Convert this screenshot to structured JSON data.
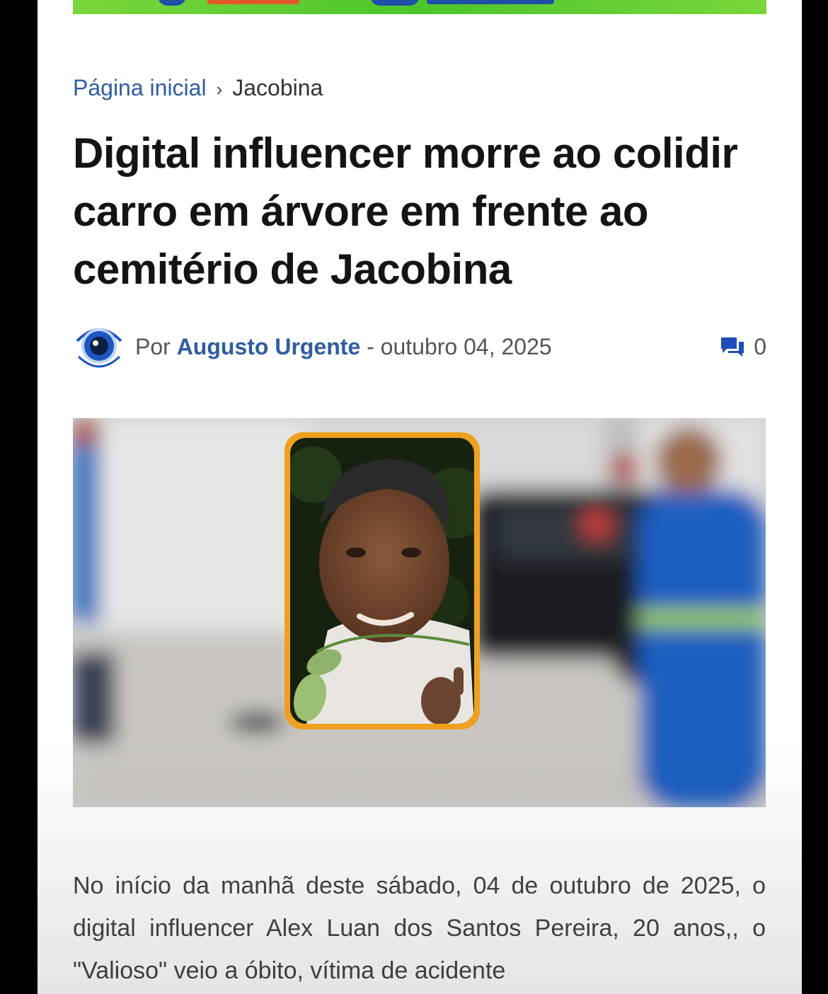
{
  "breadcrumb": {
    "home": "Página inicial",
    "separator": "›",
    "current": "Jacobina"
  },
  "article": {
    "title": "Digital influencer morre ao colidir carro em árvore em frente ao cemitério de Jacobina",
    "by_label": "Por",
    "author": "Augusto Urgente",
    "date_separator": "-",
    "date": "outubro 04, 2025",
    "comment_count": "0",
    "body": "No início da manhã deste sábado, 04 de outubro de 2025, o digital influencer Alex Luan dos Santos Pereira, 20 anos,, o \"Valioso\" veio a óbito, vítima de acidente"
  },
  "icons": {
    "avatar": "eye-logo-icon",
    "comments": "comments-icon",
    "breadcrumb_separator": "chevron-right-icon"
  },
  "colors": {
    "link": "#2f5d9f",
    "title": "#141414",
    "body_text": "#444444",
    "banner_green": "#4cc52c",
    "photo_border": "#f0a020",
    "uniform_blue": "#1f5fc0"
  }
}
